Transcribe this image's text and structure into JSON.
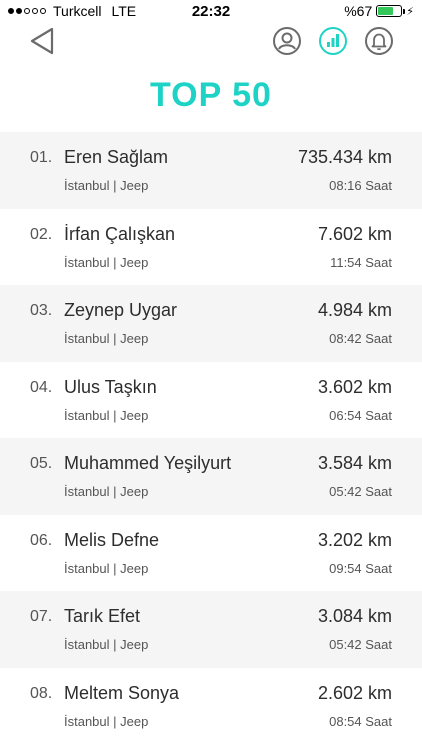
{
  "status": {
    "carrier": "Turkcell",
    "network": "LTE",
    "time": "22:32",
    "battery": "%67",
    "battery_level": 0.67
  },
  "title": "TOP 50",
  "colors": {
    "accent": "#1ed3c6",
    "battery": "#34c759"
  },
  "nav": {
    "back_icon": "back-triangle-icon",
    "icons": [
      "profile-icon",
      "leaderboard-icon",
      "bell-icon"
    ]
  },
  "rows": [
    {
      "rank": "01.",
      "name": "Eren Sağlam",
      "sub": "İstanbul | Jeep",
      "km": "735.434 km",
      "time": "08:16 Saat"
    },
    {
      "rank": "02.",
      "name": "İrfan Çalışkan",
      "sub": "İstanbul | Jeep",
      "km": "7.602 km",
      "time": "11:54 Saat"
    },
    {
      "rank": "03.",
      "name": "Zeynep Uygar",
      "sub": "İstanbul | Jeep",
      "km": "4.984 km",
      "time": "08:42 Saat"
    },
    {
      "rank": "04.",
      "name": "Ulus Taşkın",
      "sub": "İstanbul | Jeep",
      "km": "3.602 km",
      "time": "06:54 Saat"
    },
    {
      "rank": "05.",
      "name": "Muhammed Yeşilyurt",
      "sub": "İstanbul | Jeep",
      "km": "3.584 km",
      "time": "05:42 Saat"
    },
    {
      "rank": "06.",
      "name": "Melis Defne",
      "sub": "İstanbul | Jeep",
      "km": "3.202 km",
      "time": "09:54 Saat"
    },
    {
      "rank": "07.",
      "name": "Tarık Efet",
      "sub": "İstanbul | Jeep",
      "km": "3.084 km",
      "time": "05:42 Saat"
    },
    {
      "rank": "08.",
      "name": "Meltem Sonya",
      "sub": "İstanbul | Jeep",
      "km": "2.602 km",
      "time": "08:54 Saat"
    }
  ]
}
